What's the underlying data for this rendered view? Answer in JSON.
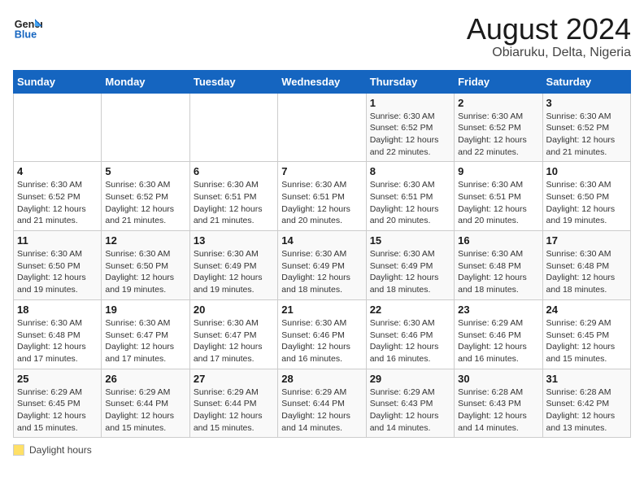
{
  "header": {
    "logo_line1": "General",
    "logo_line2": "Blue",
    "month_title": "August 2024",
    "location": "Obiaruku, Delta, Nigeria"
  },
  "days_of_week": [
    "Sunday",
    "Monday",
    "Tuesday",
    "Wednesday",
    "Thursday",
    "Friday",
    "Saturday"
  ],
  "weeks": [
    [
      {
        "day": "",
        "info": ""
      },
      {
        "day": "",
        "info": ""
      },
      {
        "day": "",
        "info": ""
      },
      {
        "day": "",
        "info": ""
      },
      {
        "day": "1",
        "info": "Sunrise: 6:30 AM\nSunset: 6:52 PM\nDaylight: 12 hours\nand 22 minutes."
      },
      {
        "day": "2",
        "info": "Sunrise: 6:30 AM\nSunset: 6:52 PM\nDaylight: 12 hours\nand 22 minutes."
      },
      {
        "day": "3",
        "info": "Sunrise: 6:30 AM\nSunset: 6:52 PM\nDaylight: 12 hours\nand 21 minutes."
      }
    ],
    [
      {
        "day": "4",
        "info": "Sunrise: 6:30 AM\nSunset: 6:52 PM\nDaylight: 12 hours\nand 21 minutes."
      },
      {
        "day": "5",
        "info": "Sunrise: 6:30 AM\nSunset: 6:52 PM\nDaylight: 12 hours\nand 21 minutes."
      },
      {
        "day": "6",
        "info": "Sunrise: 6:30 AM\nSunset: 6:51 PM\nDaylight: 12 hours\nand 21 minutes."
      },
      {
        "day": "7",
        "info": "Sunrise: 6:30 AM\nSunset: 6:51 PM\nDaylight: 12 hours\nand 20 minutes."
      },
      {
        "day": "8",
        "info": "Sunrise: 6:30 AM\nSunset: 6:51 PM\nDaylight: 12 hours\nand 20 minutes."
      },
      {
        "day": "9",
        "info": "Sunrise: 6:30 AM\nSunset: 6:51 PM\nDaylight: 12 hours\nand 20 minutes."
      },
      {
        "day": "10",
        "info": "Sunrise: 6:30 AM\nSunset: 6:50 PM\nDaylight: 12 hours\nand 19 minutes."
      }
    ],
    [
      {
        "day": "11",
        "info": "Sunrise: 6:30 AM\nSunset: 6:50 PM\nDaylight: 12 hours\nand 19 minutes."
      },
      {
        "day": "12",
        "info": "Sunrise: 6:30 AM\nSunset: 6:50 PM\nDaylight: 12 hours\nand 19 minutes."
      },
      {
        "day": "13",
        "info": "Sunrise: 6:30 AM\nSunset: 6:49 PM\nDaylight: 12 hours\nand 19 minutes."
      },
      {
        "day": "14",
        "info": "Sunrise: 6:30 AM\nSunset: 6:49 PM\nDaylight: 12 hours\nand 18 minutes."
      },
      {
        "day": "15",
        "info": "Sunrise: 6:30 AM\nSunset: 6:49 PM\nDaylight: 12 hours\nand 18 minutes."
      },
      {
        "day": "16",
        "info": "Sunrise: 6:30 AM\nSunset: 6:48 PM\nDaylight: 12 hours\nand 18 minutes."
      },
      {
        "day": "17",
        "info": "Sunrise: 6:30 AM\nSunset: 6:48 PM\nDaylight: 12 hours\nand 18 minutes."
      }
    ],
    [
      {
        "day": "18",
        "info": "Sunrise: 6:30 AM\nSunset: 6:48 PM\nDaylight: 12 hours\nand 17 minutes."
      },
      {
        "day": "19",
        "info": "Sunrise: 6:30 AM\nSunset: 6:47 PM\nDaylight: 12 hours\nand 17 minutes."
      },
      {
        "day": "20",
        "info": "Sunrise: 6:30 AM\nSunset: 6:47 PM\nDaylight: 12 hours\nand 17 minutes."
      },
      {
        "day": "21",
        "info": "Sunrise: 6:30 AM\nSunset: 6:46 PM\nDaylight: 12 hours\nand 16 minutes."
      },
      {
        "day": "22",
        "info": "Sunrise: 6:30 AM\nSunset: 6:46 PM\nDaylight: 12 hours\nand 16 minutes."
      },
      {
        "day": "23",
        "info": "Sunrise: 6:29 AM\nSunset: 6:46 PM\nDaylight: 12 hours\nand 16 minutes."
      },
      {
        "day": "24",
        "info": "Sunrise: 6:29 AM\nSunset: 6:45 PM\nDaylight: 12 hours\nand 15 minutes."
      }
    ],
    [
      {
        "day": "25",
        "info": "Sunrise: 6:29 AM\nSunset: 6:45 PM\nDaylight: 12 hours\nand 15 minutes."
      },
      {
        "day": "26",
        "info": "Sunrise: 6:29 AM\nSunset: 6:44 PM\nDaylight: 12 hours\nand 15 minutes."
      },
      {
        "day": "27",
        "info": "Sunrise: 6:29 AM\nSunset: 6:44 PM\nDaylight: 12 hours\nand 15 minutes."
      },
      {
        "day": "28",
        "info": "Sunrise: 6:29 AM\nSunset: 6:44 PM\nDaylight: 12 hours\nand 14 minutes."
      },
      {
        "day": "29",
        "info": "Sunrise: 6:29 AM\nSunset: 6:43 PM\nDaylight: 12 hours\nand 14 minutes."
      },
      {
        "day": "30",
        "info": "Sunrise: 6:28 AM\nSunset: 6:43 PM\nDaylight: 12 hours\nand 14 minutes."
      },
      {
        "day": "31",
        "info": "Sunrise: 6:28 AM\nSunset: 6:42 PM\nDaylight: 12 hours\nand 13 minutes."
      }
    ]
  ],
  "legend": {
    "box_label": "Daylight hours"
  }
}
